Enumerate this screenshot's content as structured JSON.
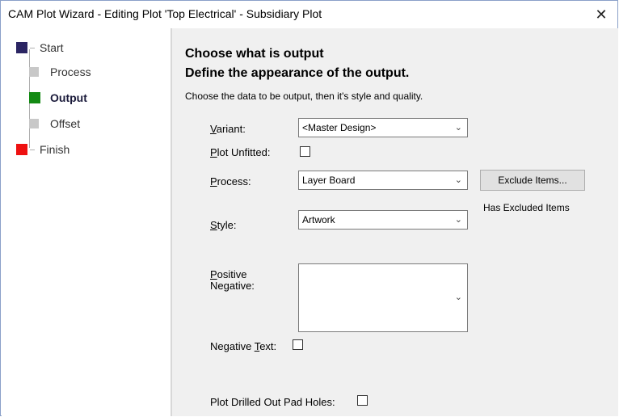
{
  "window": {
    "title": "CAM Plot Wizard - Editing Plot 'Top Electrical' - Subsidiary Plot",
    "close_glyph": "✕"
  },
  "steps": [
    {
      "label": "Start",
      "color": "#2b2563"
    },
    {
      "label": "Process",
      "color": "#c8c8c8"
    },
    {
      "label": "Output",
      "color": "#138a13"
    },
    {
      "label": "Offset",
      "color": "#c8c8c8"
    },
    {
      "label": "Finish",
      "color": "#ee1111"
    }
  ],
  "page": {
    "heading1": "Choose what is output",
    "heading2": "Define the appearance of the output.",
    "description": "Choose the data to be output, then it's style and quality."
  },
  "form": {
    "variant": {
      "label_u": "V",
      "label_rest": "ariant:",
      "value": "<Master Design>"
    },
    "plot_unfitted": {
      "label_u": "P",
      "label_rest": "lot Unfitted:",
      "checked": false
    },
    "process": {
      "label_u": "P",
      "label_rest": "rocess:",
      "value": "Layer Board"
    },
    "exclude_button": "Exclude Items...",
    "has_excluded": "Has Excluded Items",
    "style": {
      "label_u": "S",
      "label_rest": "tyle:",
      "value": "Artwork"
    },
    "positive_negative": {
      "label_u": "P",
      "label_rest1": "ositive",
      "label_line2": "Negative:"
    },
    "negative_text": {
      "label_pre": "Negative ",
      "label_u": "T",
      "label_rest": "ext:",
      "checked": false
    },
    "plot_drilled": {
      "label": "Plot Drilled Out Pad Holes:",
      "checked": false
    }
  }
}
